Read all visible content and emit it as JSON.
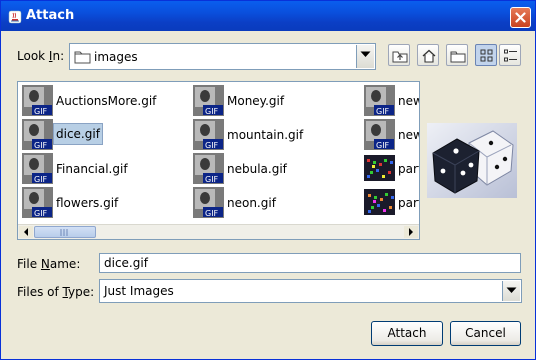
{
  "window": {
    "title": "Attach",
    "app_icon": "java-cup-icon",
    "close_icon": "close-icon"
  },
  "lookin": {
    "label_pre": "Look ",
    "label_mnemonic": "I",
    "label_post": "n:",
    "value": "images",
    "icon": "folder-icon"
  },
  "toolbar": [
    {
      "name": "up-folder-button",
      "icon": "up-folder-icon"
    },
    {
      "name": "home-button",
      "icon": "home-icon"
    },
    {
      "name": "new-folder-button",
      "icon": "new-folder-icon"
    },
    {
      "name": "list-view-button",
      "icon": "list-view-icon",
      "active": true
    },
    {
      "name": "details-view-button",
      "icon": "details-view-icon"
    }
  ],
  "files": [
    [
      "AuctionsMore.gif",
      "dice.gif",
      "Financial.gif",
      "flowers.gif"
    ],
    [
      "Money.gif",
      "mountain.gif",
      "nebula.gif",
      "neon.gif"
    ],
    [
      "new",
      "new",
      "parti",
      "parti"
    ]
  ],
  "selected_file": "dice.gif",
  "icon_badge": "GIF",
  "filename": {
    "label_pre": "File ",
    "label_mnemonic": "N",
    "label_post": "ame:",
    "value": "dice.gif"
  },
  "filetype": {
    "label_pre": "Files of ",
    "label_mnemonic": "T",
    "label_post": "ype:",
    "value": "Just Images"
  },
  "buttons": {
    "attach": "Attach",
    "cancel": "Cancel"
  },
  "colors": {
    "title_bar": "#0a4fdc",
    "selection": "#b8cfe5",
    "dialog_bg": "#ece9d8"
  }
}
